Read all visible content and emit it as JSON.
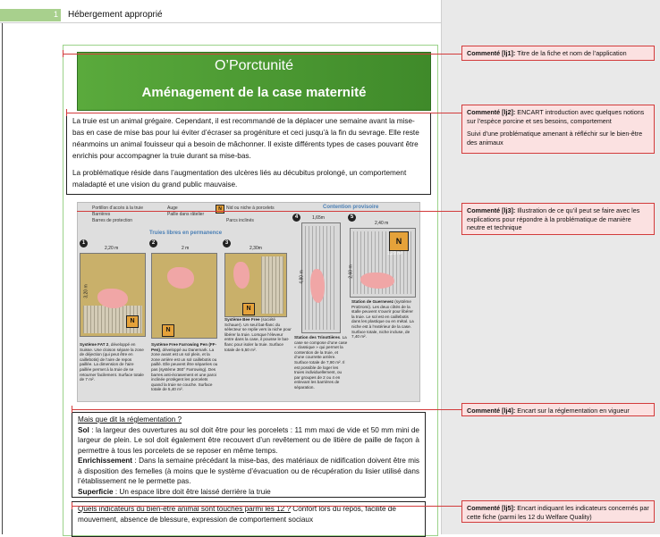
{
  "header": {
    "page_number": "1",
    "text": "Hébergement approprié"
  },
  "title": {
    "line1": "O’Porctunité",
    "line2": "Aménagement de la case maternité"
  },
  "intro": {
    "p1": "La truie est un animal grégaire. Cependant, il est recommandé de la déplacer une semaine avant la mise-bas en case de mise bas pour lui éviter d’écraser sa progéniture et ceci jusqu’à la fin du sevrage. Elle reste néanmoins un animal fouisseur qui a besoin de mâchonner.  Il existe différents types de cases pouvant être enrichis pour accompagner la truie durant sa mise-bas.",
    "p2": "La problématique réside dans l’augmentation des ulcères liés au décubitus prolongé, un comportement maladapté et une vision du grand public mauvaise."
  },
  "figure": {
    "legend": [
      "Portillon d’accès à la truie",
      "Auge",
      "Nid ou niche à porcelets",
      "Barrières",
      "Paille dans râtelier",
      "Barres de protection",
      "Parcs inclinés"
    ],
    "section_permanent": "Truies libres en permanence",
    "section_temporary": "Contention provisoire",
    "dimensions": [
      "2,20 m",
      "2 m",
      "2,30m",
      "1,65m",
      "2,40 m",
      "3,20 m",
      "4,80 m",
      "2,60 m",
      "1,20 m²"
    ],
    "captions": [
      {
        "num": "1",
        "title": "Système FAT 2",
        "text": ", développé en Suisse. Une cloison sépare la zone de déjection (qui peut être en caillebotis) de l’aire de repos paillée. La dimension de l’aire paillée permet à la truie de se retourner facilement. Surface totale de 7 m²."
      },
      {
        "num": "2",
        "title": "Système Free Farrowing Pen (FF-Pen)",
        "text": ", développé au Danemark. La zone avant est un sol plein, et la zone arrière est un sol caillebotis ou paillé. Elle peuvent être séparées ou pas (système 360° Farrowing). Des barres anti-écrasement et une paroi inclinée protègent les porcelets quand la truie se couche. Surface totale de 5,40 m²."
      },
      {
        "num": "3",
        "title": "Système Bee Free",
        "text": " (société Schauer). Un seul bat-flanc du sélecteur se replie vers la niche pour libérer la truie. Lorsque l’éleveur entre dans la case, il pousse le bat-flanc pour isoler la truie. Surface totale de 5,50 m²."
      },
      {
        "num": "4",
        "title": "Station des Trinottières",
        "text": ". La case se compose d’une case « classique » qui permet la contention de la truie, et d’une courrette arrière. Surface totale de 7,90 m². Il est possible de loger les truies individuellement, ou par groupes de 2 ou 4 en enlevant les barrières de séparation."
      },
      {
        "num": "5",
        "title": "Station de Guernevez",
        "text": " (système ProDromi). Les deux côtés de la stalle peuvent s’ouvrir pour libérer la truie. Le sol est en caillebotis dans les plastique ou en métal. La niche est à l’extérieur de la case. Surface totale, niche incluse, de 7,40 m²."
      }
    ]
  },
  "regulation": {
    "heading": "Mais que dit la réglementation ?",
    "sol_label": "Sol",
    "sol_text": " : la largeur des ouvertures au sol doit être pour les porcelets : 11 mm maxi de vide et 50 mm mini de largeur de plein. Le sol doit également être recouvert d’un revêtement ou de litière de paille de façon à permettre à tous les porcelets de se reposer en même temps.",
    "enrich_label": "Enrichissement",
    "enrich_text": " : Dans la semaine précédant la mise-bas, des matériaux de nidification doivent être mis à disposition des femelles (à moins que le système d’évacuation ou de récupération du lisier utilisé dans l’établissement ne le permette pas.",
    "surface_label": "Superficie",
    "surface_text": " : Un espace libre doit être laissé derrière la truie"
  },
  "indicators": {
    "heading": "Quels indicateurs du bien-être animal sont touchés parmi les 12 ?",
    "text": " Confort lors du repos, facilité de mouvement, absence de blessure, expression de comportement sociaux"
  },
  "comments": [
    {
      "label": "Commenté [lj1]:",
      "text": " Titre de la fiche et nom de l’application"
    },
    {
      "label": "Commenté [lj2]:",
      "text": " ENCART introduction avec quelques notions sur l’espèce porcine et ses besoins, comportement",
      "text2": "Suivi d’une problématique amenant à réfléchir sur le bien-être des animaux"
    },
    {
      "label": "Commenté [lj3]:",
      "text": " Illustration de ce qu’il peut se faire avec les explications pour répondre à la problématique de manière neutre et technique"
    },
    {
      "label": "Commenté [lj4]:",
      "text": " Encart sur la réglementation en vigueur"
    },
    {
      "label": "Commenté [lj5]:",
      "text": " Encart indiquant les indicateurs concernés par cette fiche (parmi les 12 du Welfare Quality)"
    }
  ],
  "colors": {
    "title_green": "#4e9c34",
    "comment_border": "#d23b3b",
    "comment_bg": "#fbe1e1",
    "section_blue": "#4a7fb5"
  }
}
